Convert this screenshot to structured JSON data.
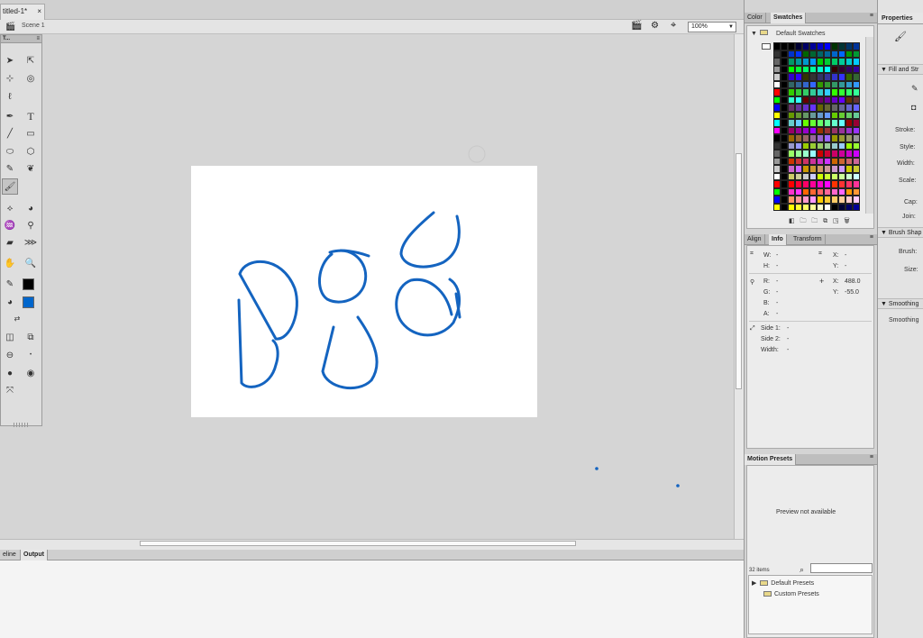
{
  "document": {
    "tab_title": "titled-1*",
    "tab_close": "×",
    "scene": "Scene 1"
  },
  "zoom": {
    "value": "100%"
  },
  "tools_panel": {
    "title": "T..."
  },
  "bottom_panel": {
    "tabs": [
      "eline",
      "Output"
    ]
  },
  "color_panel": {
    "tabs": [
      "Color",
      "Swatches"
    ],
    "folder_label": "Default Swatches"
  },
  "info_panel": {
    "tabs": [
      "Align",
      "Info",
      "Transform"
    ],
    "w_label": "W:",
    "w_value": "-",
    "h_label": "H:",
    "h_value": "-",
    "x_label": "X:",
    "x_value": "-",
    "y_label": "Y:",
    "y_value": "-",
    "r_label": "R:",
    "r_value": "-",
    "g_label": "G:",
    "g_value": "-",
    "b_label": "B:",
    "b_value": "-",
    "a_label": "A:",
    "a_value": "-",
    "cursor_x_label": "X:",
    "cursor_x": "488.0",
    "cursor_y_label": "Y:",
    "cursor_y": "-55.0",
    "side1_label": "Side 1:",
    "side1": "-",
    "side2_label": "Side 2:",
    "side2": "-",
    "width_label": "Width:",
    "width": "-"
  },
  "motion_panel": {
    "title": "Motion Presets",
    "preview": "Preview not available",
    "count": "32 items",
    "items": [
      "Default Presets",
      "Custom Presets"
    ]
  },
  "properties": {
    "title": "Properties",
    "fill_stroke": "Fill and Str",
    "stroke": "Stroke:",
    "style": "Style:",
    "width": "Width:",
    "scale": "Scale:",
    "cap": "Cap:",
    "join": "Join:",
    "brush_shape": "Brush Shap",
    "brush": "Brush:",
    "size": "Size:",
    "smoothing_section": "Smoothing",
    "smoothing": "Smoothing"
  },
  "colors": {
    "stroke_color": "#000000",
    "fill_color": "#0066cc",
    "brush_stroke": "#1464c0"
  }
}
